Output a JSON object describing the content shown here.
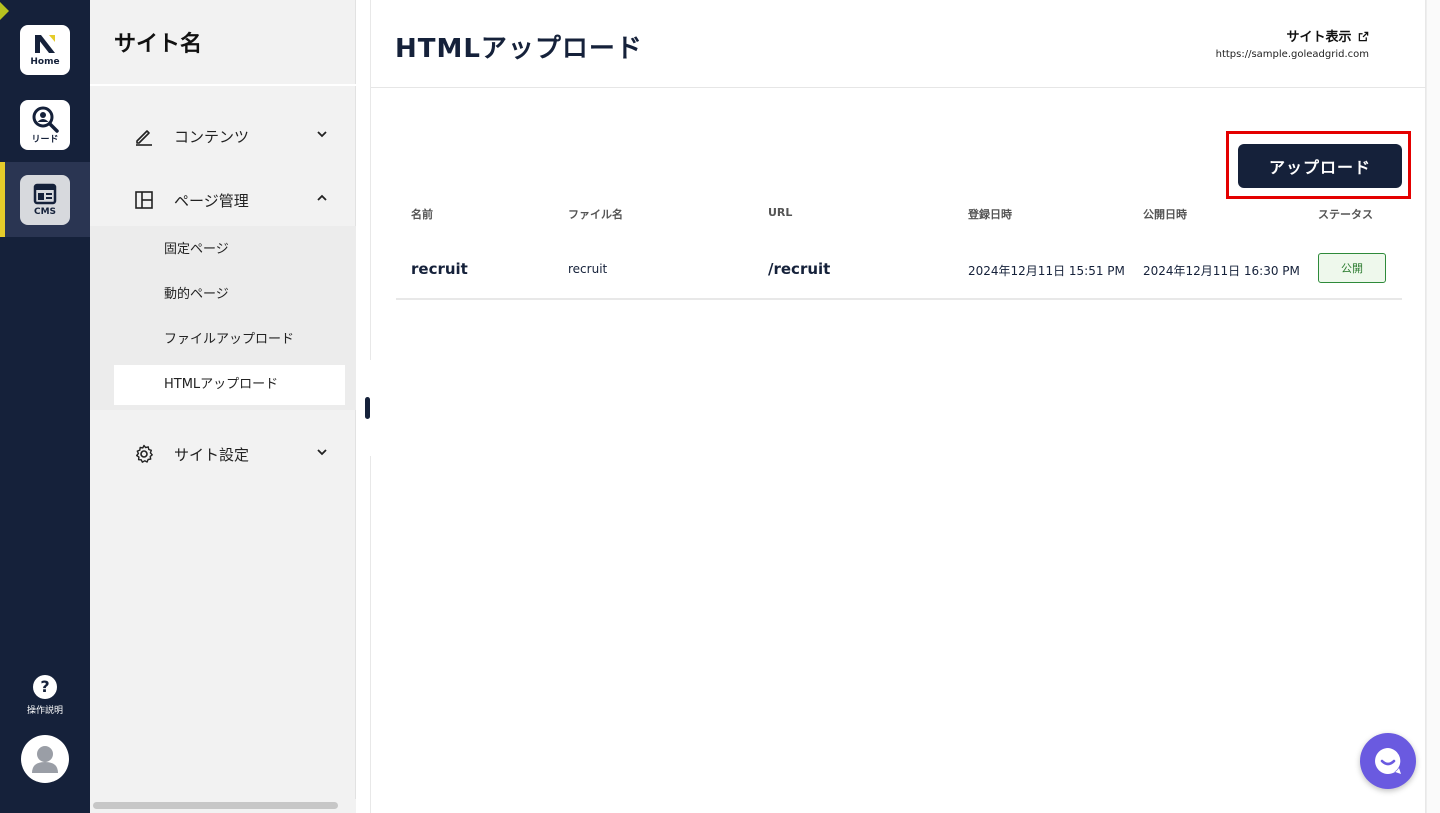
{
  "rail": {
    "home_label": "Home",
    "lead_label": "リード",
    "cms_label": "CMS",
    "help_label": "操作説明",
    "colors": {
      "background": "#15213a",
      "active_bar": "#e5cc2a"
    }
  },
  "sidebar": {
    "site_name": "サイト名",
    "items": [
      {
        "label": "コンテンツ",
        "icon": "pencil-icon",
        "expanded": false
      },
      {
        "label": "ページ管理",
        "icon": "layout-icon",
        "expanded": true
      },
      {
        "label": "サイト設定",
        "icon": "gear-icon",
        "expanded": false
      }
    ],
    "sub_items": [
      {
        "label": "固定ページ"
      },
      {
        "label": "動的ページ"
      },
      {
        "label": "ファイルアップロード"
      },
      {
        "label": "HTMLアップロード",
        "active": true
      }
    ]
  },
  "header": {
    "title": "HTMLアップロード",
    "site_link_label": "サイト表示",
    "site_url": "https://sample.goleadgrid.com"
  },
  "toolbar": {
    "upload_label": "アップロード"
  },
  "table": {
    "columns": [
      "名前",
      "ファイル名",
      "URL",
      "登録日時",
      "公開日時",
      "ステータス"
    ],
    "rows": [
      {
        "name": "recruit",
        "file_name": "recruit",
        "url": "/recruit",
        "created": "2024年12月11日 15:51 PM",
        "published": "2024年12月11日 16:30 PM",
        "status": "公開"
      }
    ]
  },
  "colors": {
    "primary": "#15213a",
    "highlight": "#e40000",
    "status_green": "#2e7d32",
    "chat": "#6a5ae0"
  }
}
